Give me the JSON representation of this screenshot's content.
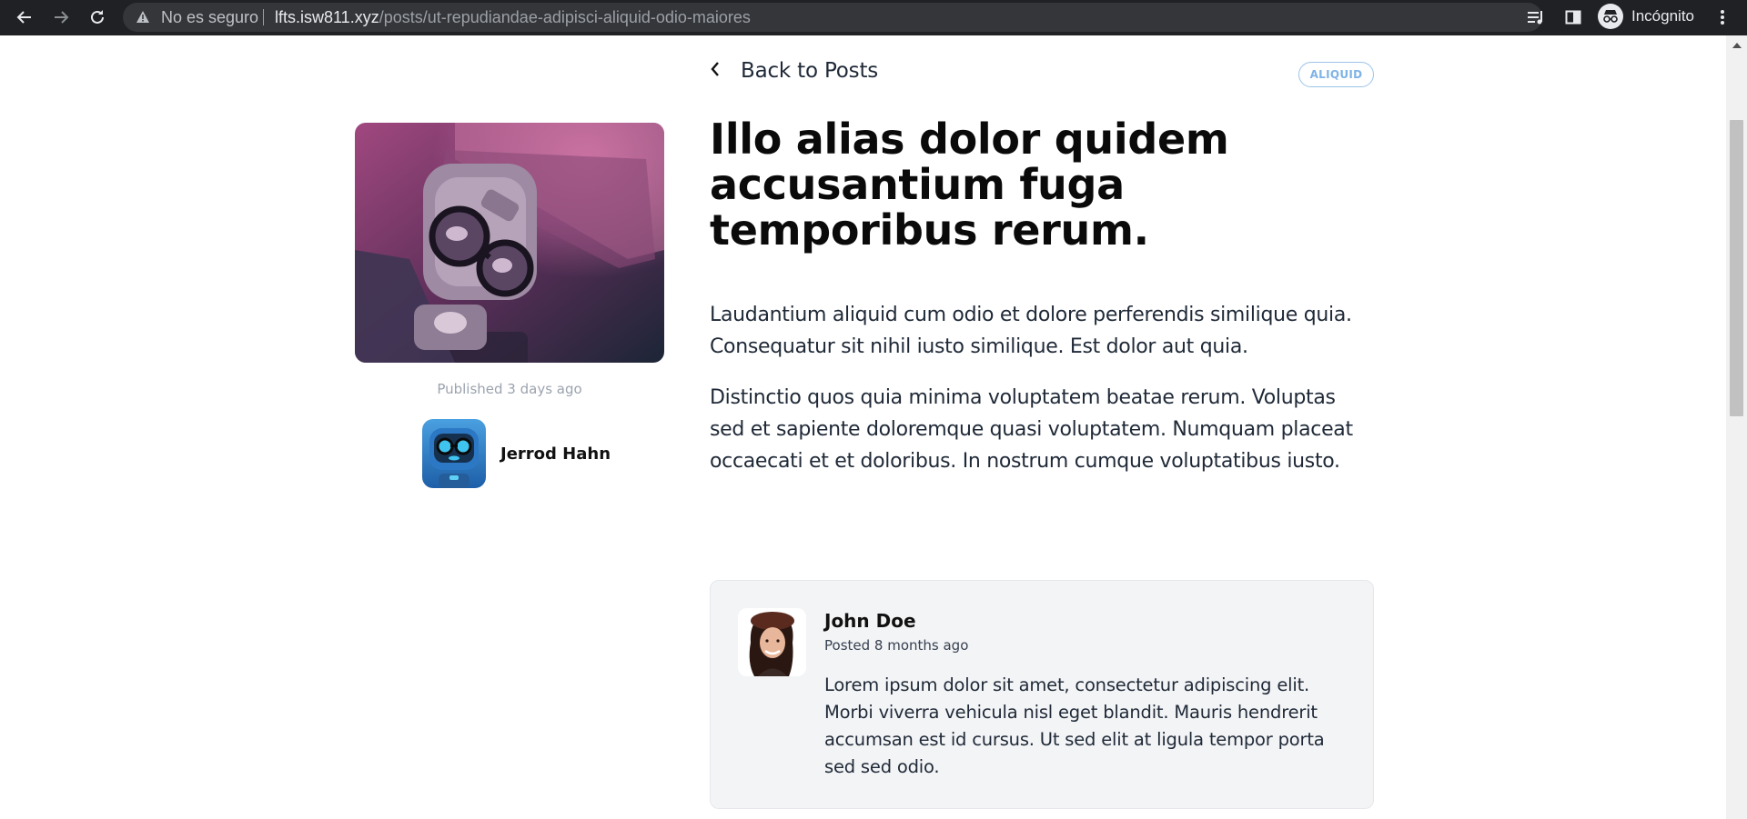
{
  "browser": {
    "security_label": "No es seguro",
    "url_host": "lfts.isw811.xyz",
    "url_path": "/posts/ut-repudiandae-adipisci-aliquid-odio-maiores",
    "profile_label": "Incógnito"
  },
  "post": {
    "back_label": "Back to Posts",
    "category": "ALIQUID",
    "title": "Illo alias dolor quidem accusantium fuga temporibus rerum.",
    "paragraphs": [
      "Laudantium aliquid cum odio et dolore perferendis similique quia. Consequatur sit nihil iusto similique. Est dolor aut quia.",
      "Distinctio quos quia minima voluptatem beatae rerum. Voluptas sed et sapiente doloremque quasi voluptatem. Numquam placeat occaecati et et doloribus. In nostrum cumque voluptatibus iusto."
    ],
    "published": "Published 3 days ago",
    "author": "Jerrod Hahn"
  },
  "comments": [
    {
      "author": "John Doe",
      "date": "Posted 8 months ago",
      "body": "Lorem ipsum dolor sit amet, consectetur adipiscing elit. Morbi viverra vehicula nisl eget blandit. Mauris hendrerit accumsan est id cursus. Ut sed elit at ligula tempor porta sed sed odio."
    }
  ],
  "colors": {
    "category_accent": "#7fb3e6",
    "chrome_bg": "#202124",
    "comment_bg": "#f3f4f6"
  },
  "icons": [
    "back-arrow-icon",
    "forward-arrow-icon",
    "reload-icon",
    "warning-icon",
    "bookmark-star-icon",
    "reading-list-icon",
    "side-panel-icon",
    "incognito-icon",
    "kebab-menu-icon",
    "chevron-left-icon"
  ]
}
